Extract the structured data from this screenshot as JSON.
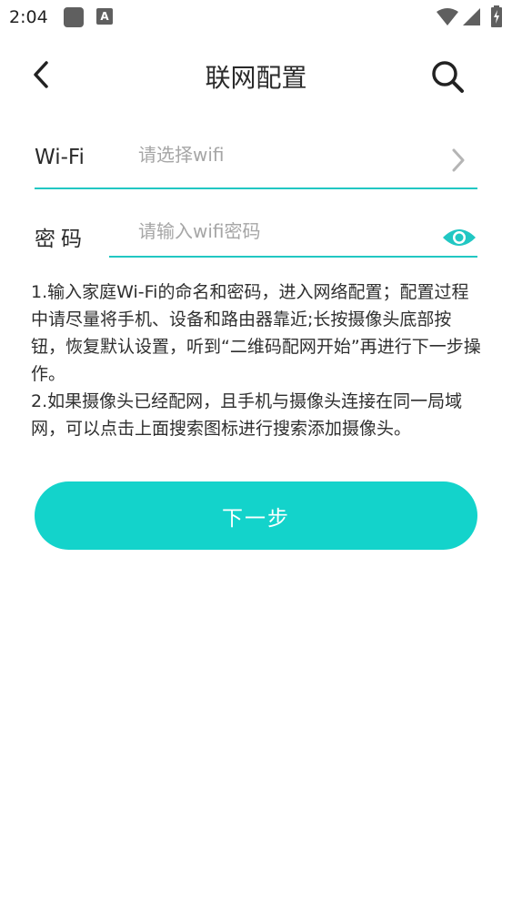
{
  "status_bar": {
    "time": "2:04",
    "a_badge": "A",
    "icons": [
      "app-notification-icon",
      "accessibility-a-icon",
      "wifi-icon",
      "signal-icon",
      "battery-charging-icon"
    ]
  },
  "header": {
    "title": "联网配置",
    "back_icon": "chevron-left-icon",
    "search_icon": "search-icon"
  },
  "wifi_field": {
    "label": "Wi-Fi",
    "placeholder": "请选择wifi",
    "value": ""
  },
  "password_field": {
    "label": "密码",
    "placeholder": "请输入wifi密码",
    "value": ""
  },
  "instructions": {
    "line1": "1.输入家庭Wi-Fi的命名和密码，进入网络配置；配置过程中请尽量将手机、设备和路由器靠近;长按摄像头底部按钮，恢复默认设置，听到“二维码配网开始”再进行下一步操作。",
    "line2": "2.如果摄像头已经配网，且手机与摄像头连接在同一局域网，可以点击上面搜索图标进行搜索添加摄像头。"
  },
  "next_button": {
    "label": "下一步"
  },
  "colors": {
    "accent": "#13d3cb",
    "underline": "#21c7c3",
    "text": "#2a2a2a",
    "placeholder": "#a6a6a6"
  }
}
